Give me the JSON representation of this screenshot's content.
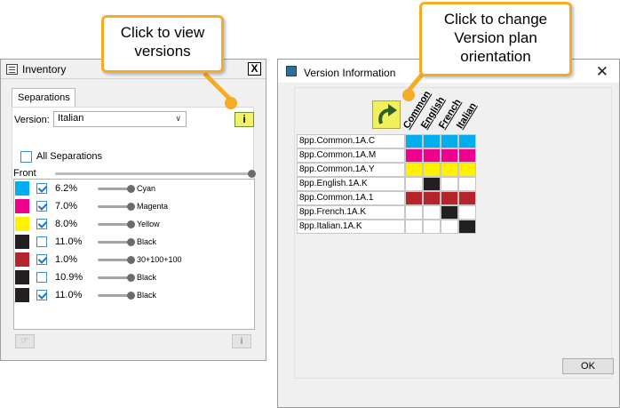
{
  "callouts": {
    "view_versions": "Click to view versions",
    "change_orientation": "Click to change Version plan orientation"
  },
  "inventory": {
    "title": "Inventory",
    "close_glyph": "X",
    "tab_label": "Separations",
    "version_label": "Version:",
    "version_value": "Italian",
    "info_button_label": "i",
    "all_separations_label": "All Separations",
    "front_label": "Front",
    "separations": [
      {
        "color": "#00aeef",
        "checked": true,
        "percent": "6.2%",
        "name": "Cyan"
      },
      {
        "color": "#ec008c",
        "checked": true,
        "percent": "7.0%",
        "name": "Magenta"
      },
      {
        "color": "#fff200",
        "checked": true,
        "percent": "8.0%",
        "name": "Yellow"
      },
      {
        "color": "#231f20",
        "checked": false,
        "percent": "11.0%",
        "name": "Black"
      },
      {
        "color": "#b5232d",
        "checked": true,
        "percent": "1.0%",
        "name": "30+100+100"
      },
      {
        "color": "#231f20",
        "checked": false,
        "percent": "10.9%",
        "name": "Black"
      },
      {
        "color": "#231f20",
        "checked": true,
        "percent": "11.0%",
        "name": "Black"
      }
    ],
    "bottom_right_label": "i"
  },
  "version_info": {
    "title": "Version Information",
    "close_glyph": "✕",
    "columns": [
      "Common",
      "English",
      "French",
      "Italian"
    ],
    "rows": [
      {
        "label": "8pp.Common.1A.C",
        "cells": [
          "#00aeef",
          "#00aeef",
          "#00aeef",
          "#00aeef"
        ]
      },
      {
        "label": "8pp.Common.1A.M",
        "cells": [
          "#ec008c",
          "#ec008c",
          "#ec008c",
          "#ec008c"
        ]
      },
      {
        "label": "8pp.Common.1A.Y",
        "cells": [
          "#fff200",
          "#fff200",
          "#fff200",
          "#fff200"
        ]
      },
      {
        "label": "8pp.English.1A.K",
        "cells": [
          "#ffffff",
          "#231f20",
          "#ffffff",
          "#ffffff"
        ]
      },
      {
        "label": "8pp.Common.1A.1",
        "cells": [
          "#b5232d",
          "#b5232d",
          "#b5232d",
          "#b5232d"
        ]
      },
      {
        "label": "8pp.French.1A.K",
        "cells": [
          "#ffffff",
          "#ffffff",
          "#231f20",
          "#ffffff"
        ]
      },
      {
        "label": "8pp.Italian.1A.K",
        "cells": [
          "#ffffff",
          "#ffffff",
          "#ffffff",
          "#231f20"
        ]
      }
    ],
    "ok_label": "OK"
  },
  "icons": {
    "orientation": "curved-arrow-icon",
    "inventory": "list-window-icon",
    "app": "cube-icon"
  },
  "colors": {
    "callout_border": "#f5ab26",
    "info_button": "#f2f26a"
  }
}
